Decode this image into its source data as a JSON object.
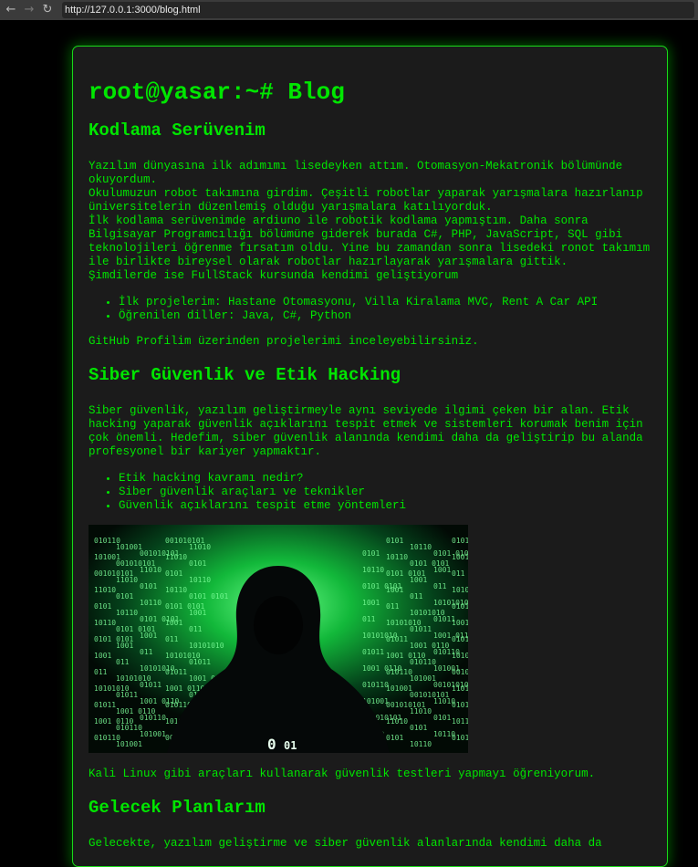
{
  "browser": {
    "back": "←",
    "forward": "→",
    "reload": "↻",
    "url": "http://127.0.0.1:3000/blog.html"
  },
  "page": {
    "title": "root@yasar:~# Blog",
    "sections": [
      {
        "heading": "Kodlama Serüvenim",
        "paragraphs": [
          "Yazılım dünyasına ilk adımımı lisedeyken attım. Otomasyon-Mekatronik bölümünde okuyordum.",
          "Okulumuzun robot takımına girdim. Çeşitli robotlar yaparak yarışmalara hazırlanıp üniversitelerin düzenlemiş olduğu yarışmalara katılıyorduk.",
          "İlk kodlama serüvenimde ardiuno ile robotik kodlama yapmıştım. Daha sonra Bilgisayar Programcılığı bölümüne giderek burada C#, PHP, JavaScript, SQL gibi teknolojileri öğrenme fırsatım oldu. Yine bu zamandan sonra lisedeki ronot takımım ile birlikte bireysel olarak robotlar hazırlayarak yarışmalara gittik.",
          "Şimdilerde ise FullStack kursunda kendimi geliştiyorum"
        ],
        "list": [
          "İlk projelerim: Hastane Otomasyonu, Villa Kiralama MVC, Rent A Car API",
          "Öğrenilen diller: Java, C#, Python"
        ],
        "footer": "GitHub Profilim üzerinden projelerimi inceleyebilirsiniz."
      },
      {
        "heading": "Siber Güvenlik ve Etik Hacking",
        "paragraph": "Siber güvenlik, yazılım geliştirmeyle aynı seviyede ilgimi çeken bir alan. Etik hacking yaparak güvenlik açıklarını tespit etmek ve sistemleri korumak benim için çok önemli. Hedefim, siber güvenlik alanında kendimi daha da geliştirip bu alanda profesyonel bir kariyer yapmaktır.",
        "list": [
          "Etik hacking kavramı nedir?",
          "Siber güvenlik araçları ve teknikler",
          "Güvenlik açıklarını tespit etme yöntemleri"
        ],
        "after_image": "Kali Linux gibi araçları kullanarak güvenlik testleri yapmayı öğreniyorum."
      },
      {
        "heading": "Gelecek Planlarım",
        "paragraph": "Gelecekte, yazılım geliştirme ve siber güvenlik alanlarında kendimi daha da"
      }
    ],
    "image_binary": [
      "010110",
      "101001",
      "001010101",
      "11010",
      "0101",
      "10110",
      "0101 0101",
      "1001",
      "011",
      "10101010",
      "01011",
      "1001 0110"
    ]
  }
}
